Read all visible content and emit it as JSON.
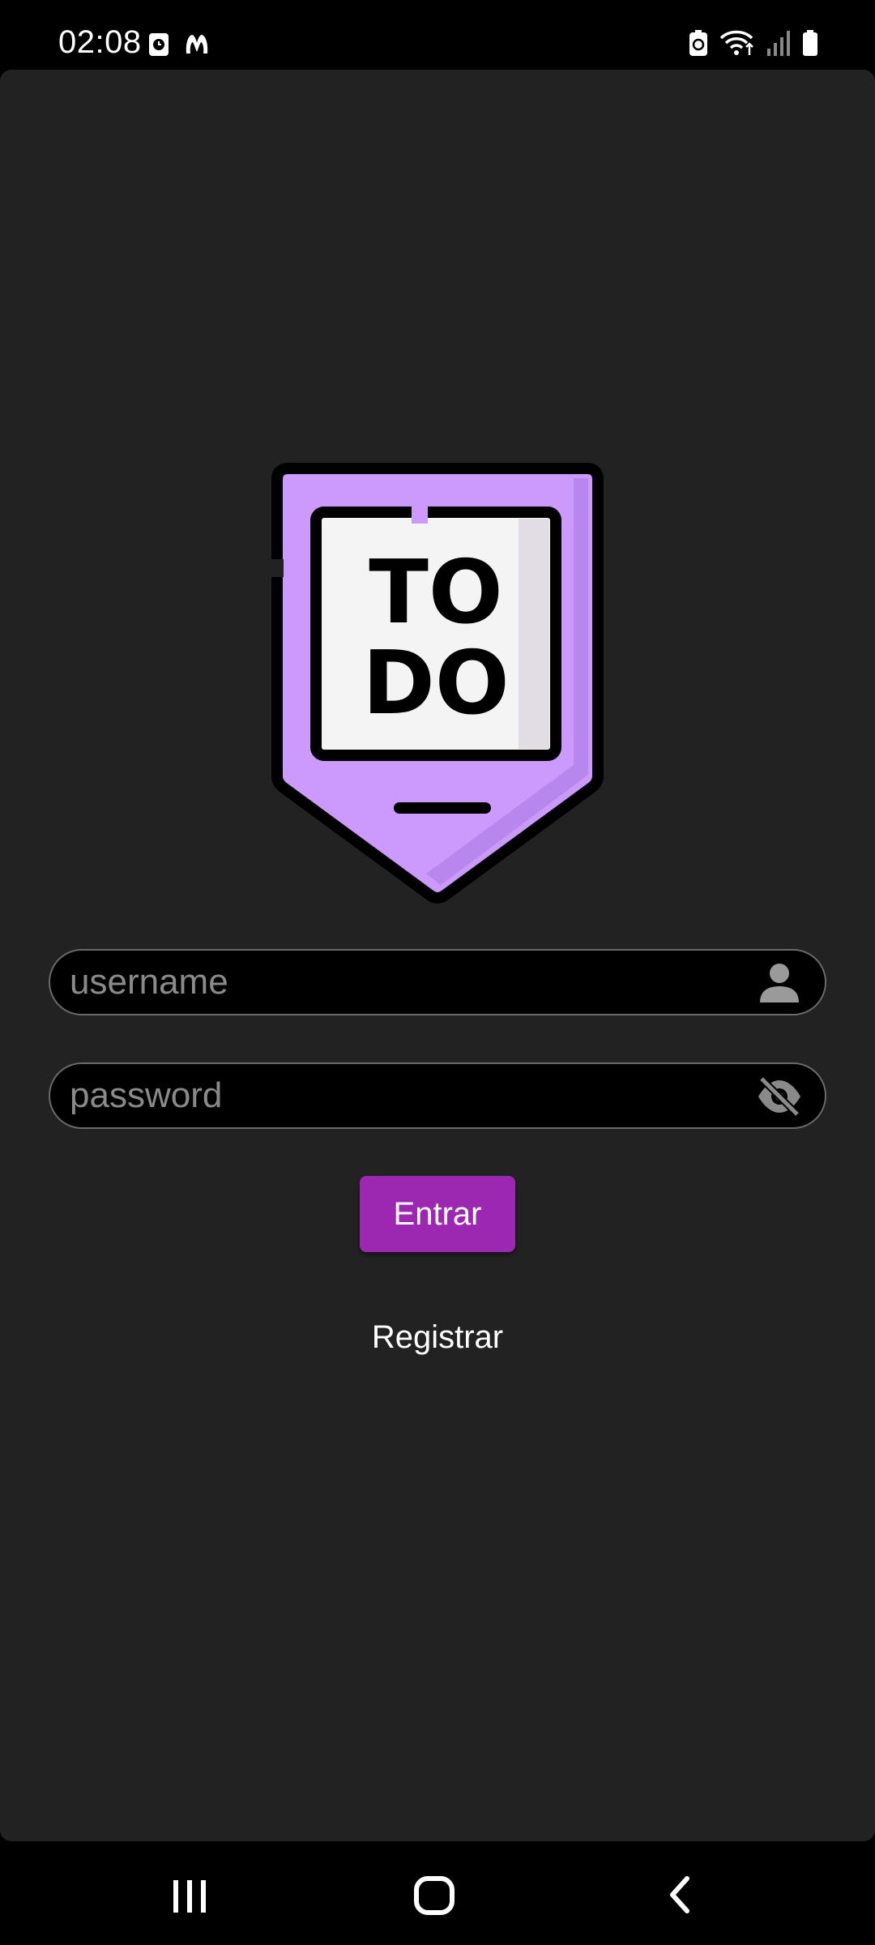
{
  "status_bar": {
    "time": "02:08",
    "left_icons": [
      "alarm-app-icon",
      "malwarebytes-icon"
    ],
    "right_icons": [
      "battery-saver-icon",
      "wifi-icon",
      "signal-icon",
      "battery-icon"
    ]
  },
  "logo": {
    "text_line1": "TO",
    "text_line2": "DO",
    "colors": {
      "badge": "#cc99fd",
      "badge_shade": "#b787ee",
      "card": "#f4f4f4",
      "outline": "#000000"
    }
  },
  "form": {
    "username": {
      "placeholder": "username",
      "value": "",
      "icon": "person-icon"
    },
    "password": {
      "placeholder": "password",
      "value": "",
      "icon": "visibility-off-icon"
    },
    "enter_label": "Entrar",
    "register_label": "Registrar"
  },
  "colors": {
    "accent": "#9c27b0",
    "surface": "#222222",
    "background": "#000000"
  },
  "nav_bar": {
    "buttons": [
      "recents-icon",
      "home-icon",
      "back-icon"
    ]
  }
}
